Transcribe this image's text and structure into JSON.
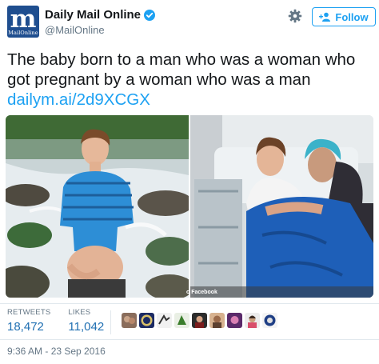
{
  "account": {
    "logo_letter": "m",
    "logo_text": "MailOnline",
    "name": "Daily Mail Online",
    "handle": "@MailOnline",
    "verified": true
  },
  "actions": {
    "follow_label": "Follow"
  },
  "tweet": {
    "text": "The baby born to a man who was a woman who got pregnant by a woman who was a man",
    "link": "dailym.ai/2d9XCGX",
    "photo_caption": "o Facebook"
  },
  "stats": {
    "retweets_label": "RETWEETS",
    "retweets": "18,472",
    "likes_label": "LIKES",
    "likes": "11,042"
  },
  "timestamp": "9:36 AM - 23 Sep 2016",
  "colors": {
    "accent": "#1da1f2",
    "logo_bg": "#1f4e8f",
    "text": "#14171a",
    "muted": "#657786"
  }
}
